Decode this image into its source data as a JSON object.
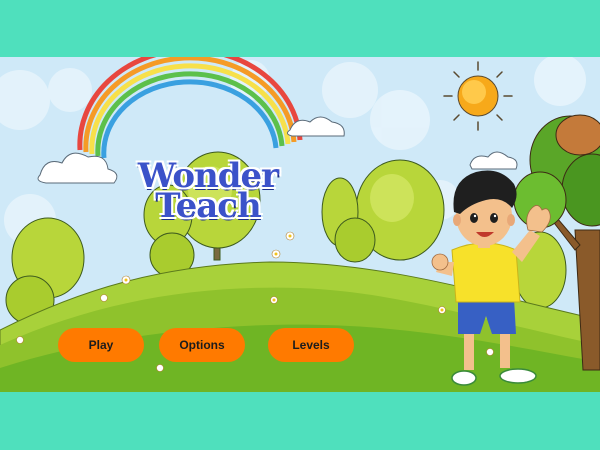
{
  "title": {
    "line1": "Wonder",
    "line2": "Teach"
  },
  "menu": {
    "play_label": "Play",
    "options_label": "Options",
    "levels_label": "Levels"
  },
  "colors": {
    "frame": "#4fe0bd",
    "sky": "#cfe9f8",
    "button": "#ff7a00",
    "title": "#3b52c9"
  }
}
